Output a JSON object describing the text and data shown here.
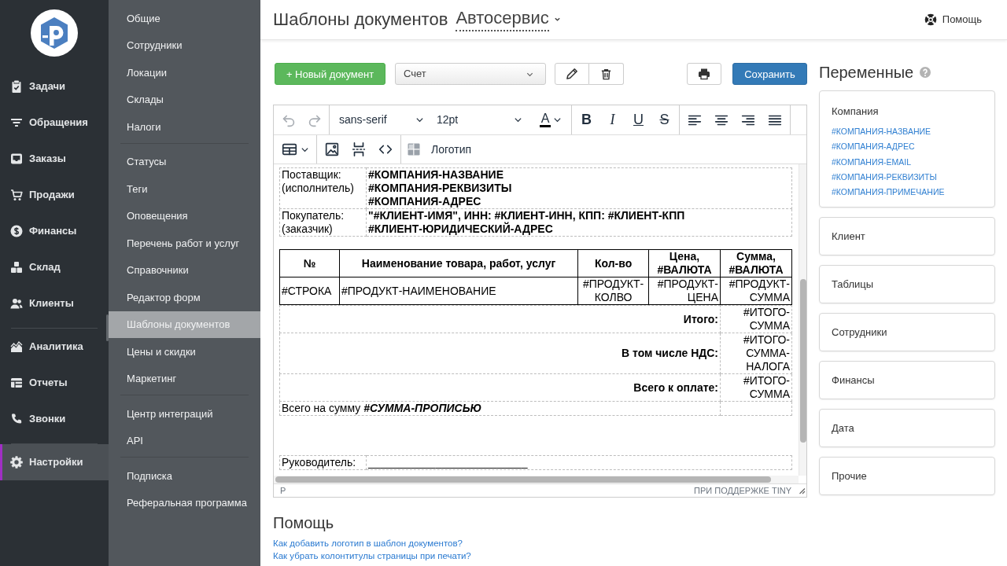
{
  "main_nav": {
    "groups": [
      {
        "items": [
          {
            "label": "Задачи",
            "selected": false
          },
          {
            "label": "Обращения",
            "selected": false
          },
          {
            "label": "Заказы",
            "selected": false
          },
          {
            "label": "Продажи",
            "selected": false
          },
          {
            "label": "Финансы",
            "selected": false
          },
          {
            "label": "Склад",
            "selected": false
          },
          {
            "label": "Клиенты",
            "selected": false
          }
        ]
      },
      {
        "items": [
          {
            "label": "Аналитика",
            "selected": false
          },
          {
            "label": "Отчеты",
            "selected": false
          },
          {
            "label": "Звонки",
            "selected": false
          }
        ]
      },
      {
        "items": [
          {
            "label": "Настройки",
            "selected": true
          }
        ]
      }
    ]
  },
  "settings_nav": {
    "groups": [
      {
        "items": [
          {
            "label": "Общие",
            "selected": false
          },
          {
            "label": "Сотрудники",
            "selected": false
          },
          {
            "label": "Локации",
            "selected": false
          },
          {
            "label": "Склады",
            "selected": false
          },
          {
            "label": "Налоги",
            "selected": false
          }
        ]
      },
      {
        "items": [
          {
            "label": "Статусы",
            "selected": false
          },
          {
            "label": "Теги",
            "selected": false
          },
          {
            "label": "Оповещения",
            "selected": false
          },
          {
            "label": "Перечень работ и услуг",
            "selected": false
          },
          {
            "label": "Справочники",
            "selected": false
          },
          {
            "label": "Редактор форм",
            "selected": false
          },
          {
            "label": "Шаблоны документов",
            "selected": true
          },
          {
            "label": "Цены и скидки",
            "selected": false
          },
          {
            "label": "Маркетинг",
            "selected": false
          }
        ]
      },
      {
        "items": [
          {
            "label": "Центр интеграций",
            "selected": false
          },
          {
            "label": "API",
            "selected": false
          }
        ]
      },
      {
        "items": [
          {
            "label": "Подписка",
            "selected": false
          },
          {
            "label": "Реферальная программа",
            "selected": false
          }
        ]
      }
    ]
  },
  "header": {
    "title": "Шаблоны документов",
    "company": "Автосервис",
    "help": "Помощь"
  },
  "actions": {
    "new_document": "+ Новый документ",
    "template": {
      "value": "Счет"
    },
    "save": "Сохранить"
  },
  "editor": {
    "toolbar": {
      "history": [
        {
          "kind": "undo",
          "disabled": true
        },
        {
          "kind": "redo",
          "disabled": true
        }
      ],
      "font_family": "sans-serif",
      "font_size": "12pt",
      "text_color": "A",
      "formats": [
        {
          "kind": "bold",
          "label": "B"
        },
        {
          "kind": "italic",
          "label": "I"
        },
        {
          "kind": "underline",
          "label": "U"
        },
        {
          "kind": "strikethrough",
          "label": "S"
        }
      ],
      "logo": "Логотип"
    },
    "document": {
      "parties": [
        {
          "label": [
            "Поставщик:",
            "(исполнитель)"
          ],
          "value": [
            "#КОМПАНИЯ-НАЗВАНИЕ",
            "#КОМПАНИЯ-РЕКВИЗИТЫ",
            "#КОМПАНИЯ-АДРЕС"
          ]
        },
        {
          "label": [
            "Покупатель:",
            "(заказчик)"
          ],
          "value": [
            "\"#КЛИЕНТ-ИМЯ\", ИНН: #КЛИЕНТ-ИНН, КПП: #КЛИЕНТ-КПП",
            "#КЛИЕНТ-ЮРИДИЧЕСКИЙ-АДРЕС"
          ]
        }
      ],
      "table": {
        "columns": [
          "№",
          "Наименование товара, работ, услуг",
          "Кол-во",
          "Цена, #ВАЛЮТА",
          "Сумма, #ВАЛЮТА"
        ],
        "rows": [
          [
            "#СТРОКА",
            "#ПРОДУКТ-НАИМЕНОВАНИЕ",
            "#ПРОДУКТ-КОЛВО",
            "#ПРОДУКТ-ЦЕНА",
            "#ПРОДУКТ-СУММА"
          ]
        ]
      },
      "totals": [
        {
          "label": "Итого:",
          "value": "#ИТОГО-СУММА"
        },
        {
          "label": "В том числе НДС:",
          "value": "#ИТОГО-СУММА-НАЛОГА"
        },
        {
          "label": "Всего к оплате:",
          "value": "#ИТОГО-СУММА"
        }
      ],
      "amount_in_words": "Всего на сумму **#СУММА-ПРОПИСЬЮ**",
      "signature": {
        "label": "Руководитель:",
        "blank": "__________________________"
      }
    },
    "status_path": "P",
    "branding": "ПРИ ПОДДЕРЖКЕ TINY"
  },
  "help": {
    "title": "Помощь",
    "links": [
      "Как добавить логотип в шаблон документов?",
      "Как убрать колонтитулы страницы при печати?"
    ]
  },
  "variables": {
    "title": "Переменные",
    "groups": [
      {
        "title": "Компания",
        "expanded": true,
        "items": [
          "#КОМПАНИЯ-НАЗВАНИЕ",
          "#КОМПАНИЯ-АДРЕС",
          "#КОМПАНИЯ-EMAIL",
          "#КОМПАНИЯ-РЕКВИЗИТЫ",
          "#КОМПАНИЯ-ПРИМЕЧАНИЕ"
        ]
      },
      {
        "title": "Клиент",
        "expanded": false
      },
      {
        "title": "Таблицы",
        "expanded": false
      },
      {
        "title": "Сотрудники",
        "expanded": false
      },
      {
        "title": "Финансы",
        "expanded": false
      },
      {
        "title": "Дата",
        "expanded": false
      },
      {
        "title": "Прочие",
        "expanded": false
      }
    ]
  }
}
